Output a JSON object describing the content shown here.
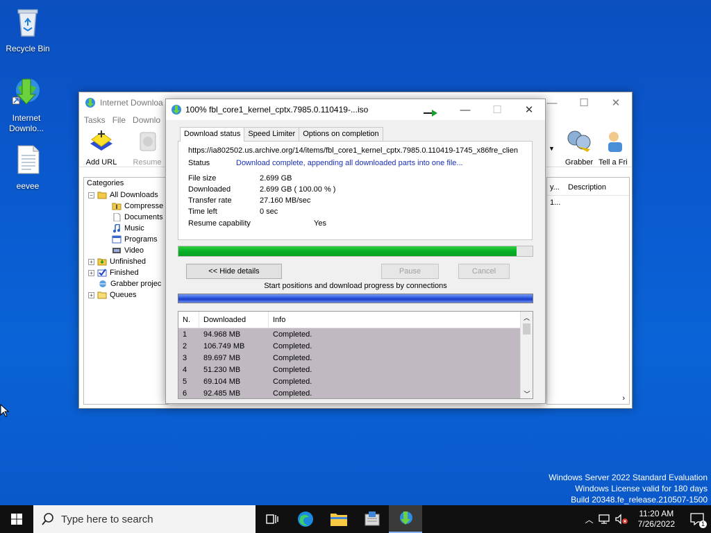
{
  "desktop": {
    "icons": [
      {
        "label": "Recycle Bin"
      },
      {
        "label": "Internet Downlo..."
      },
      {
        "label": "eevee"
      }
    ]
  },
  "main_window": {
    "title": "Internet Downloa",
    "menu": [
      "Tasks",
      "File",
      "Downlo"
    ],
    "toolbar": {
      "add_url": "Add URL",
      "resume": "Resume",
      "grabber": "Grabber",
      "tell_friend": "Tell a Fri"
    },
    "categories": {
      "header": "Categories",
      "all_downloads": "All Downloads",
      "compressed": "Compresse",
      "documents": "Documents",
      "music": "Music",
      "programs": "Programs",
      "video": "Video",
      "unfinished": "Unfinished",
      "finished": "Finished",
      "grabber_projects": "Grabber projec",
      "queues": "Queues"
    },
    "list": {
      "col_partial": "y...",
      "col_description": "Description",
      "cell_partial": "1..."
    }
  },
  "dialog": {
    "title": "100% fbl_core1_kernel_cptx.7985.0.110419-...iso",
    "tabs": [
      "Download status",
      "Speed Limiter",
      "Options on completion"
    ],
    "url": "https://ia802502.us.archive.org/14/items/fbl_core1_kernel_cptx.7985.0.110419-1745_x86fre_clien",
    "status_label": "Status",
    "status_value": "Download complete, appending all downloaded parts into one file...",
    "file_size_label": "File size",
    "file_size_value": "2.699  GB",
    "downloaded_label": "Downloaded",
    "downloaded_value": "2.699  GB  ( 100.00 % )",
    "transfer_rate_label": "Transfer rate",
    "transfer_rate_value": "27.160  MB/sec",
    "time_left_label": "Time left",
    "time_left_value": "0 sec",
    "resume_label": "Resume capability",
    "resume_value": "Yes",
    "progress": 0.955,
    "buttons": {
      "hide_details": "<< Hide details",
      "pause": "Pause",
      "cancel": "Cancel"
    },
    "connections_label": "Start positions and download progress by connections",
    "table": {
      "headers": [
        "N.",
        "Downloaded",
        "Info"
      ],
      "rows": [
        {
          "n": "1",
          "downloaded": "94.968  MB",
          "info": "Completed."
        },
        {
          "n": "2",
          "downloaded": "106.749  MB",
          "info": "Completed."
        },
        {
          "n": "3",
          "downloaded": "89.697  MB",
          "info": "Completed."
        },
        {
          "n": "4",
          "downloaded": "51.230  MB",
          "info": "Completed."
        },
        {
          "n": "5",
          "downloaded": "69.104  MB",
          "info": "Completed."
        },
        {
          "n": "6",
          "downloaded": "92.485  MB",
          "info": "Completed."
        }
      ]
    }
  },
  "watermark": {
    "line1": "Windows Server 2022 Standard Evaluation",
    "line2": "Windows License valid for 180 days",
    "line3": "Build 20348.fe_release.210507-1500"
  },
  "taskbar": {
    "search_placeholder": "Type here to search",
    "time": "11:20 AM",
    "date": "7/26/2022",
    "notification_count": "1"
  }
}
